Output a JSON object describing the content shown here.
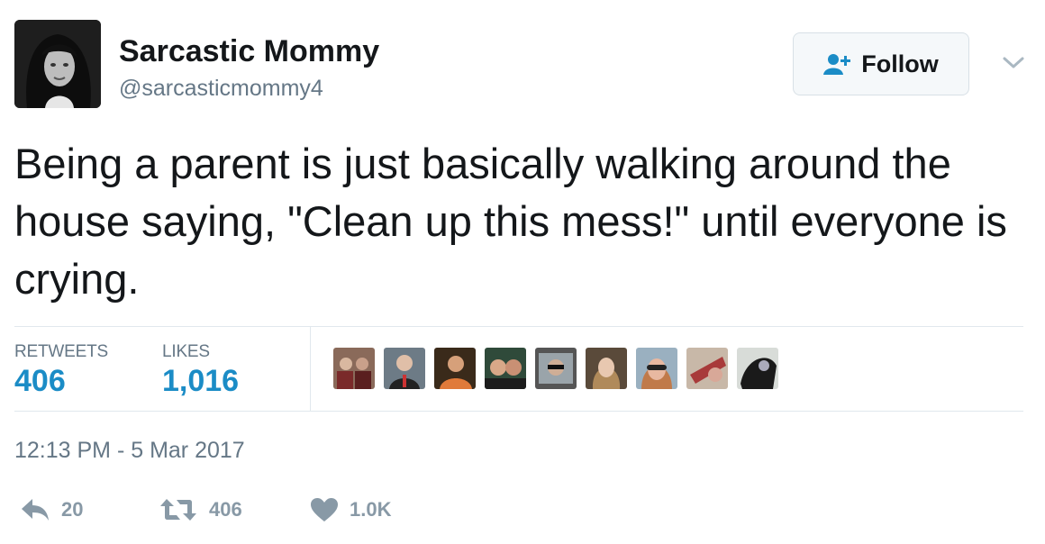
{
  "user": {
    "name": "Sarcastic Mommy",
    "handle": "@sarcasticmommy4"
  },
  "follow_button": {
    "label": "Follow",
    "icon": "person-add-icon"
  },
  "menu": {
    "icon": "chevron-down-icon"
  },
  "tweet": {
    "text": "Being a parent is just basically walking around the house saying, \"Clean up this mess!\" until everyone is crying."
  },
  "stats": {
    "retweets_label": "RETWEETS",
    "retweets_value": "406",
    "likes_label": "LIKES",
    "likes_value": "1,016"
  },
  "timestamp": "12:13 PM - 5 Mar 2017",
  "actions": {
    "reply_count": "20",
    "retweet_count": "406",
    "like_count": "1.0K"
  },
  "colors": {
    "link_blue": "#1b8cc6",
    "muted_gray": "#657786",
    "icon_gray": "#8899a6",
    "divider": "#e1e8ed"
  }
}
